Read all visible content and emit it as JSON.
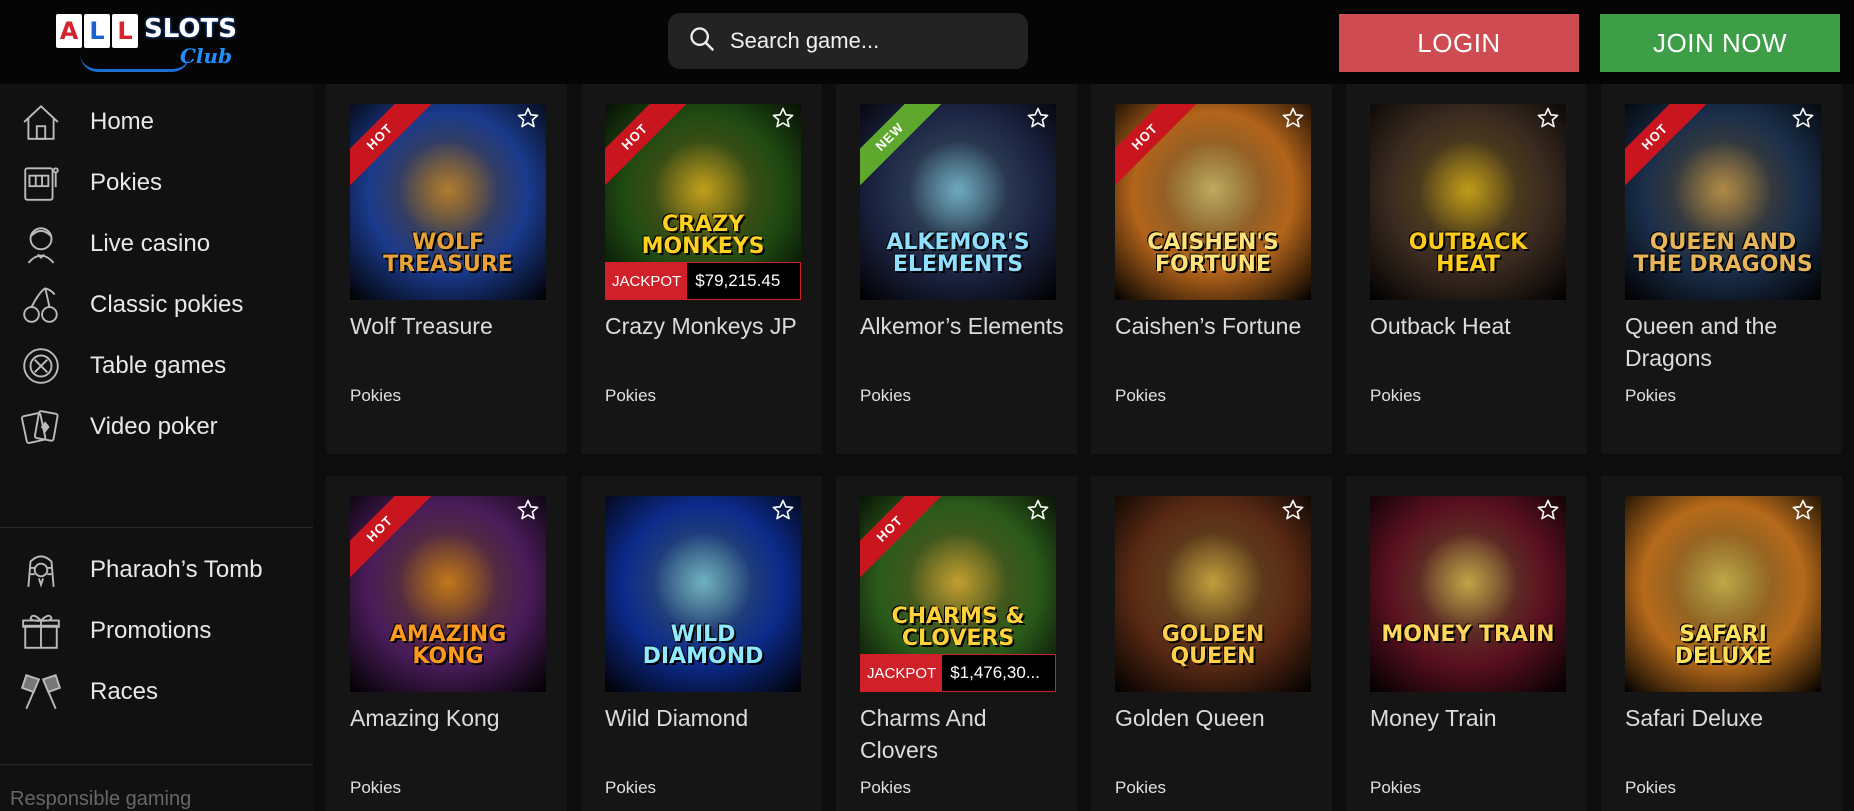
{
  "header": {
    "logo": {
      "all": [
        "A",
        "L",
        "L"
      ],
      "slots": "SLOTS",
      "club": "Club"
    },
    "search_placeholder": "Search game...",
    "login_label": "LOGIN",
    "join_label": "JOIN NOW"
  },
  "sidebar": {
    "items": [
      {
        "label": "Home",
        "icon": "home-icon"
      },
      {
        "label": "Pokies",
        "icon": "slot-machine-icon"
      },
      {
        "label": "Live casino",
        "icon": "dealer-icon"
      },
      {
        "label": "Classic pokies",
        "icon": "cherries-icon"
      },
      {
        "label": "Table games",
        "icon": "roulette-icon"
      },
      {
        "label": "Video poker",
        "icon": "cards-icon"
      },
      {
        "label": "Pharaoh’s Tomb",
        "icon": "pharaoh-icon"
      },
      {
        "label": "Promotions",
        "icon": "gift-icon"
      },
      {
        "label": "Races",
        "icon": "racing-flags-icon"
      }
    ],
    "responsible": "Responsible gaming"
  },
  "games": [
    {
      "name": "Wolf Treasure",
      "category": "Pokies",
      "badge": "HOT",
      "art_title": "WOLF TREASURE",
      "bg": "#1a3a8c",
      "accent": "#e8a23a",
      "jackpot": null
    },
    {
      "name": "Crazy Monkeys JP",
      "category": "Pokies",
      "badge": "HOT",
      "art_title": "CRAZY MONKEYS",
      "bg": "#1f4a12",
      "accent": "#ffd21f",
      "jackpot": {
        "label": "JACKPOT",
        "value": "$79,215.45"
      }
    },
    {
      "name": "Alkemor’s Elements",
      "category": "Pokies",
      "badge": "NEW",
      "art_title": "ALKEMOR'S ELEMENTS",
      "bg": "#1d2545",
      "accent": "#8fe0ff",
      "jackpot": null
    },
    {
      "name": "Caishen’s Fortune",
      "category": "Pokies",
      "badge": "HOT",
      "art_title": "Caishen's Fortune",
      "bg": "#b3641a",
      "accent": "#ffe27a",
      "jackpot": null
    },
    {
      "name": "Outback Heat",
      "category": "Pokies",
      "badge": "",
      "art_title": "OUTBACK HEAT",
      "bg": "#3a2a20",
      "accent": "#ffcc1a",
      "jackpot": null
    },
    {
      "name": "Queen and the Dragons",
      "category": "Pokies",
      "badge": "HOT",
      "art_title": "QUEEN AND THE DRAGONS",
      "bg": "#1a2e4a",
      "accent": "#e7b55a",
      "jackpot": null
    },
    {
      "name": "Amazing Kong",
      "category": "Pokies",
      "badge": "HOT",
      "art_title": "AMAZING KONG",
      "bg": "#4a1c5a",
      "accent": "#ff9a1f",
      "jackpot": null
    },
    {
      "name": "Wild Diamond",
      "category": "Pokies",
      "badge": "",
      "art_title": "WILD DIAMOND",
      "bg": "#0c2a8a",
      "accent": "#8fe9ff",
      "jackpot": null
    },
    {
      "name": "Charms And Clovers",
      "category": "Pokies",
      "badge": "HOT",
      "art_title": "Charms & Clovers",
      "bg": "#2a5a1a",
      "accent": "#ffd23a",
      "jackpot": {
        "label": "JACKPOT",
        "value": "$1,476,30..."
      }
    },
    {
      "name": "Golden Queen",
      "category": "Pokies",
      "badge": "",
      "art_title": "GOLDEN QUEEN",
      "bg": "#5a2a14",
      "accent": "#ffcf4a",
      "jackpot": null
    },
    {
      "name": "Money Train",
      "category": "Pokies",
      "badge": "",
      "art_title": "MONEY TRAIN",
      "bg": "#5a1020",
      "accent": "#ffd65a",
      "jackpot": null
    },
    {
      "name": "Safari Deluxe",
      "category": "Pokies",
      "badge": "",
      "art_title": "SAFARI DELUXE",
      "bg": "#b66a1a",
      "accent": "#ffe05a",
      "jackpot": null
    }
  ]
}
